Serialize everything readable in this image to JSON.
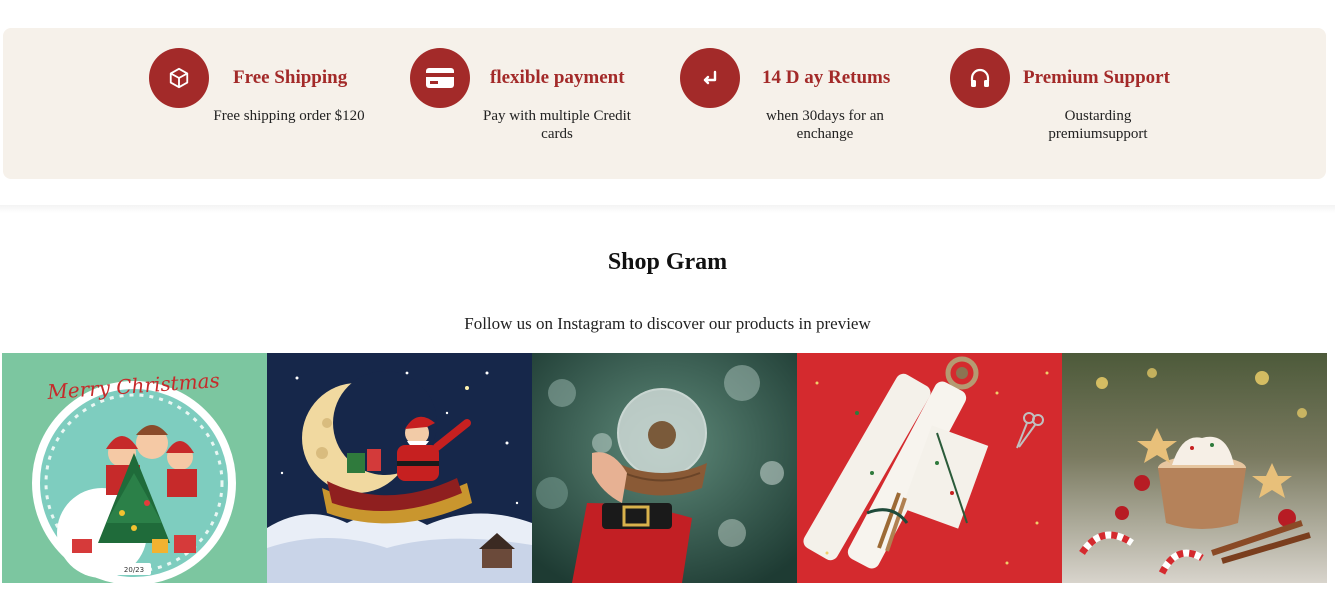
{
  "features": [
    {
      "icon": "box-icon",
      "title": "Free Shipping",
      "description": "Free shipping order $120"
    },
    {
      "icon": "credit-card-icon",
      "title": "flexible payment",
      "description": "Pay with multiple Credit cards"
    },
    {
      "icon": "return-arrow-icon",
      "title": "14 D ay Retums",
      "description": "when 30days for an enchange"
    },
    {
      "icon": "headphones-icon",
      "title": "Premium Support",
      "description": "Oustarding premiumsupport"
    }
  ],
  "shop_gram": {
    "title": "Shop Gram",
    "subtitle": "Follow us on Instagram to discover our products in preview",
    "images": [
      {
        "image_text": "Merry Christmas",
        "image_year": "20/23"
      },
      {},
      {},
      {},
      {}
    ]
  },
  "colors": {
    "accent": "#a32a29",
    "features_background": "#f6f1ea"
  }
}
